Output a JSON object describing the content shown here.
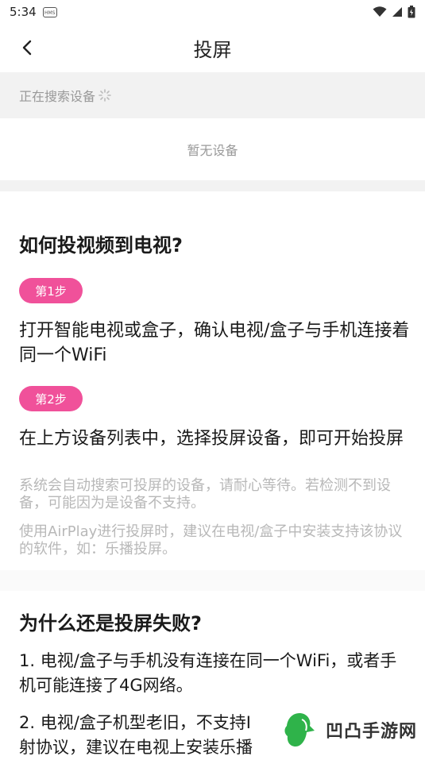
{
  "status_bar": {
    "time": "5:34",
    "hms_label": "HMS"
  },
  "header": {
    "title": "投屏"
  },
  "search": {
    "status_text": "正在搜索设备"
  },
  "devices": {
    "empty_text": "暂无设备"
  },
  "howto": {
    "title": "如何投视频到电视?",
    "step1_badge": "第1步",
    "step1_text": "打开智能电视或盒子，确认电视/盒子与手机连接着同一个WiFi",
    "step2_badge": "第2步",
    "step2_text": "在上方设备列表中，选择投屏设备，即可开始投屏",
    "note1": "系统会自动搜索可投屏的设备，请耐心等待。若检测不到设备，可能因为是设备不支持。",
    "note2": "使用AirPlay进行投屏时，建议在电视/盒子中安装支持该协议的软件，如：乐播投屏。"
  },
  "failure": {
    "title": "为什么还是投屏失败?",
    "item1": "1. 电视/盒子与手机没有连接在同一个WiFi，或者手机可能连接了4G网络。",
    "item2": "2. 电视/盒子机型老旧，不支持I",
    "item2_line2": "射协议，建议在电视上安装乐播"
  },
  "watermark": {
    "text": "凹凸手游网"
  },
  "colors": {
    "accent": "#f0519a",
    "background_band": "#f2f2f2",
    "muted_text": "#999999"
  }
}
